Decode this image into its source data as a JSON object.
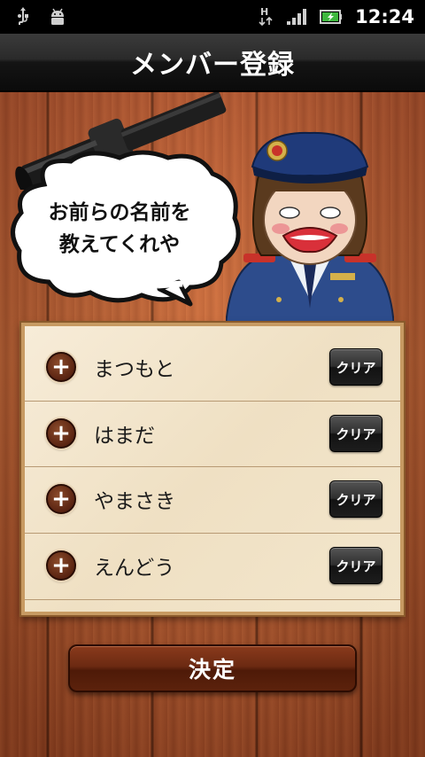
{
  "status_bar": {
    "time": "12:24",
    "icons": [
      "usb-icon",
      "android-debug-icon",
      "data-hsdpa-icon",
      "signal-icon",
      "battery-icon"
    ]
  },
  "title_bar": {
    "title": "メンバー登録"
  },
  "bubble": {
    "text": "お前らの名前を\n教えてくれや"
  },
  "members": [
    {
      "name": "まつもと",
      "add_icon": "plus-icon",
      "clear_label": "クリア"
    },
    {
      "name": "はまだ",
      "add_icon": "plus-icon",
      "clear_label": "クリア"
    },
    {
      "name": "やまさき",
      "add_icon": "plus-icon",
      "clear_label": "クリア"
    },
    {
      "name": "えんどう",
      "add_icon": "plus-icon",
      "clear_label": "クリア"
    }
  ],
  "confirm": {
    "label": "決定"
  },
  "colors": {
    "wood": "#b8532d",
    "panel": "#f3e6cc",
    "confirm_button": "#6c2a12",
    "clear_button": "#1d1d1d"
  }
}
